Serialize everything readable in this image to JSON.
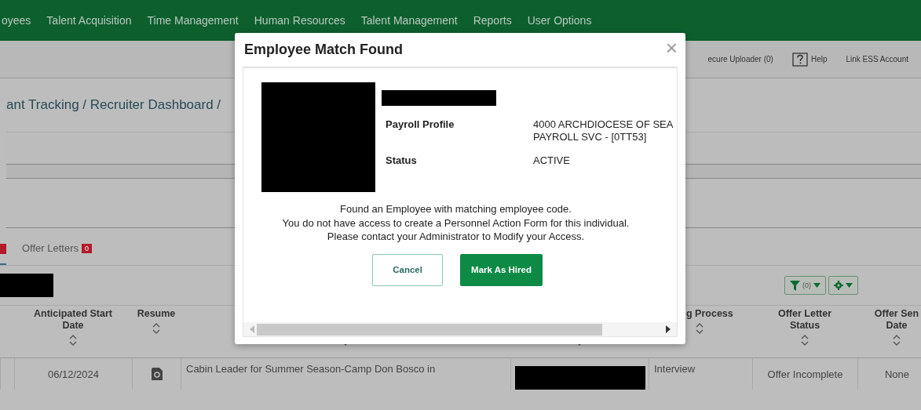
{
  "nav": {
    "items": [
      "oyees",
      "Talent Acquisition",
      "Time Management",
      "Human Resources",
      "Talent Management",
      "Reports",
      "User Options"
    ]
  },
  "utility_links": [
    {
      "label": "ecure Uploader (0)",
      "kind": "text"
    },
    {
      "label": "Help",
      "kind": "help"
    },
    {
      "label": "Link ESS Account",
      "kind": "text"
    }
  ],
  "breadcrumb": "ant Tracking / Recruiter Dashboard /",
  "tabs": [
    {
      "kind": "partial",
      "selected": true
    },
    {
      "kind": "full",
      "label": "Offer Letters",
      "badge": "0",
      "selected": false
    }
  ],
  "toolbar": {
    "filter_label": "(0)"
  },
  "table": {
    "columns": [
      {
        "label": [
          "Anticipated Start",
          "Date"
        ]
      },
      {
        "label": [
          "Resume"
        ]
      },
      {},
      {},
      {
        "label": [
          "g Process"
        ],
        "kind": "partial"
      },
      {
        "label": [
          "Offer Letter",
          "Status"
        ]
      },
      {
        "label": [
          "Offer Sen",
          "Date"
        ]
      }
    ],
    "rows": [
      {
        "start_date": "06/12/2024",
        "job_title": "Cabin Leader for Summer Season-Camp Don Bosco in",
        "hiring_process": "Interview",
        "offer_letter_status": "Offer Incomplete",
        "offer_sent_date": "None"
      }
    ]
  },
  "dialog": {
    "title": "Employee Match Found",
    "close": "×",
    "fields": [
      {
        "label": "Payroll Profile",
        "value": [
          "4000 ARCHDIOCESE OF SEA",
          "PAYROLL SVC - [0TT53]"
        ]
      },
      {
        "label": "Status",
        "value": [
          "ACTIVE"
        ]
      }
    ],
    "message": [
      "Found an Employee with matching employee code.",
      "You do not have access to create a Personnel Action Form for this individual.",
      "Please contact your Administrator to Modify your Access."
    ],
    "buttons": [
      {
        "label": "Cancel",
        "kind": "secondary"
      },
      {
        "label": "Mark As Hired",
        "kind": "primary"
      }
    ]
  }
}
